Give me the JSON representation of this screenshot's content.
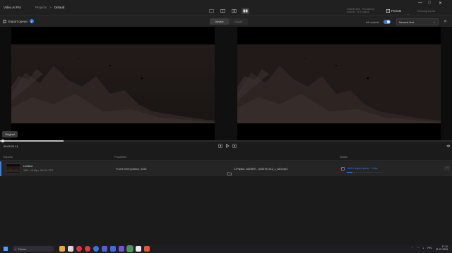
{
  "titlebar": {
    "app": "Video AI Pro",
    "breadcrumb_root": "Projects",
    "breadcrumb_sep": ">",
    "breadcrumb_current": "Default",
    "status_hint": "Output used · Remaining exports · of 3 videos",
    "presets_label": "Presets",
    "check_updates_label": "Checking license",
    "minimize": "—",
    "maximize": "□",
    "close": "✕"
  },
  "toolbar": {
    "export_queue": "Export queue",
    "info": "i",
    "mode_device": "Device",
    "mode_cloud": "Cloud",
    "all_models": "All models",
    "select_value": "Newest first",
    "close": "✕"
  },
  "preview": {
    "badge": "Original"
  },
  "timeline": {
    "timecode": "00:00:01:11",
    "progress": 0.14,
    "prev": "◁",
    "play": "▷",
    "next": "▷",
    "fullscreen": "⤢"
  },
  "table": {
    "headers": {
      "exports": "Exports",
      "properties": "Properties",
      "status": "Status"
    },
    "rows": [
      {
        "name": "Untitled",
        "meta": "3840 × 2160px, 00:0:01 PTS",
        "model": "Frame Interpolation, h265",
        "path": "C:/Papka/...5423909 - 10432701.012_1_c#10.mp4",
        "status": "Add to export queue  · 0 files",
        "progress": 0.16,
        "more": "···"
      }
    ]
  },
  "taskbar": {
    "search": "Поиск",
    "lang": "РУС",
    "time": "17:10",
    "date": "31.07.2025"
  },
  "colors": {
    "accent": "#3b7de0",
    "bg": "#1b1b1b"
  }
}
